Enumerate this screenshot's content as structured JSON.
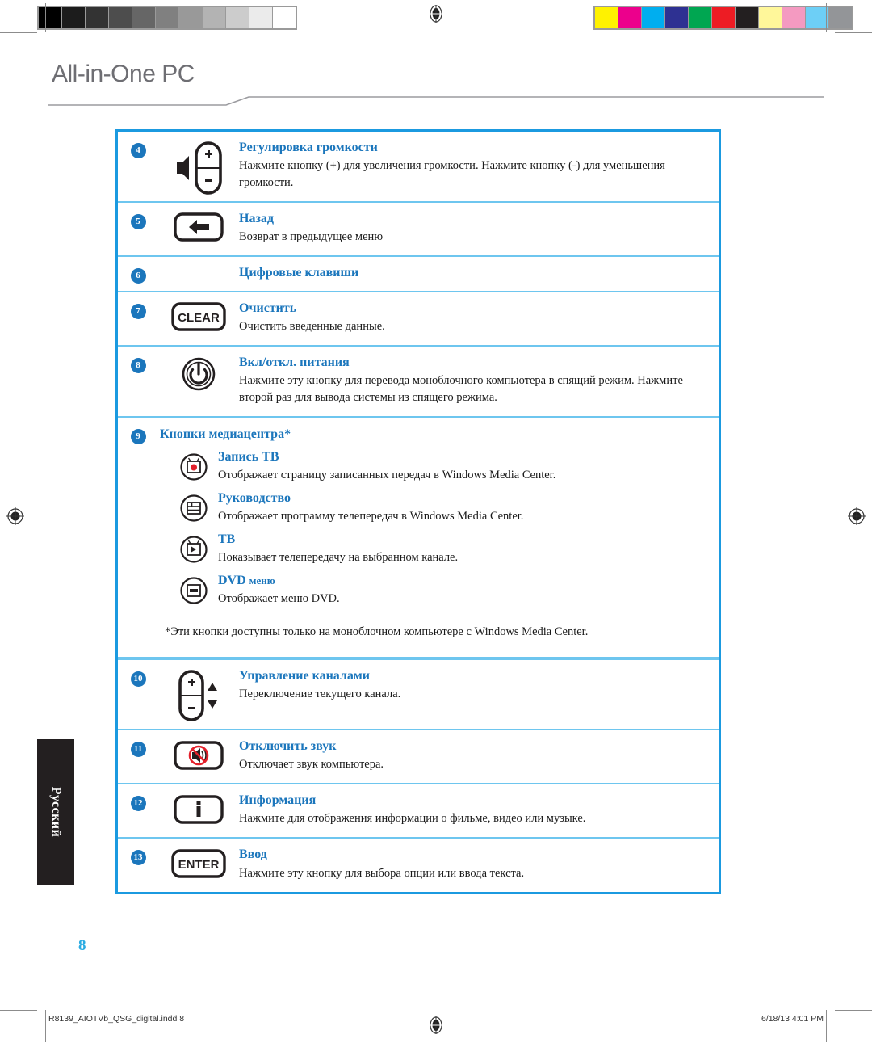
{
  "header": {
    "title": "All-in-One PC"
  },
  "language_tab": {
    "label": "Русский"
  },
  "page_number": "8",
  "footer": {
    "filename": "R8139_AIOTVb_QSG_digital.indd   8",
    "timestamp": "6/18/13   4:01 PM"
  },
  "calibration": {
    "grayscale": [
      "#000000",
      "#1c1c1c",
      "#333333",
      "#4d4d4d",
      "#666666",
      "#808080",
      "#999999",
      "#b3b3b3",
      "#cccccc",
      "#ebebeb",
      "#ffffff"
    ],
    "colors": [
      "#fff200",
      "#ec008c",
      "#00aeef",
      "#2e3192",
      "#00a651",
      "#ed1c24",
      "#231f20",
      "#fff79a",
      "#f49ac1",
      "#6dcff6",
      "#939598"
    ]
  },
  "accent": {
    "table_border": "#1b9ae0",
    "row_divider": "#6ec6ef",
    "heading": "#1b76bc",
    "badge": "#1b76bc",
    "page_number": "#29abe2"
  },
  "rows": [
    {
      "number": "4",
      "icon": "volume-rocker-icon",
      "title": "Регулировка громкости",
      "desc": "Нажмите кнопку (+) для увеличения громкости. Нажмите кнопку (-) для уменьшения громкости."
    },
    {
      "number": "5",
      "icon": "back-arrow-button-icon",
      "title": "Назад",
      "desc": "Возврат в предыдущее меню"
    },
    {
      "number": "6",
      "icon": "",
      "title": "Цифровые клавиши",
      "desc": ""
    },
    {
      "number": "7",
      "icon": "clear-button-icon",
      "title": "Очистить",
      "desc": "Очистить введенные данные."
    },
    {
      "number": "8",
      "icon": "power-button-icon",
      "title": "Вкл/откл. питания",
      "desc": "Нажмите эту кнопку для перевода моноблочного компьютера в спящий режим. Нажмите второй раз для вывода системы из спящего режима."
    }
  ],
  "media_center": {
    "number": "9",
    "title": "Кнопки медиацентра*",
    "items": [
      {
        "icon": "tv-record-icon",
        "title": "Запись ТВ",
        "desc": "Отображает страницу записанных передач в Windows Media Center."
      },
      {
        "icon": "guide-grid-icon",
        "title": "Руководство",
        "desc": "Отображает программу телепередач в Windows Media Center."
      },
      {
        "icon": "tv-play-icon",
        "title": "ТВ",
        "desc": "Показывает телепередачу на выбранном канале."
      },
      {
        "icon": "dvd-menu-icon",
        "title": "DVD",
        "title_sub": "меню",
        "desc": "Отображает меню DVD."
      }
    ],
    "footnote": "*Эти кнопки доступны только на моноблочном компьютере с Windows Media Center."
  },
  "rows_bottom": [
    {
      "number": "10",
      "icon": "channel-rocker-icon",
      "title": "Управление каналами",
      "desc": "Переключение текущего канала."
    },
    {
      "number": "11",
      "icon": "mute-button-icon",
      "title": "Отключить звук",
      "desc": "Отключает звук компьютера."
    },
    {
      "number": "12",
      "icon": "info-button-icon",
      "title": "Информация",
      "desc": "Нажмите для отображения информации о фильме, видео или музыке."
    },
    {
      "number": "13",
      "icon": "enter-button-icon",
      "title": "Ввод",
      "desc": "Нажмите эту кнопку для выбора опции или ввода текста."
    }
  ]
}
